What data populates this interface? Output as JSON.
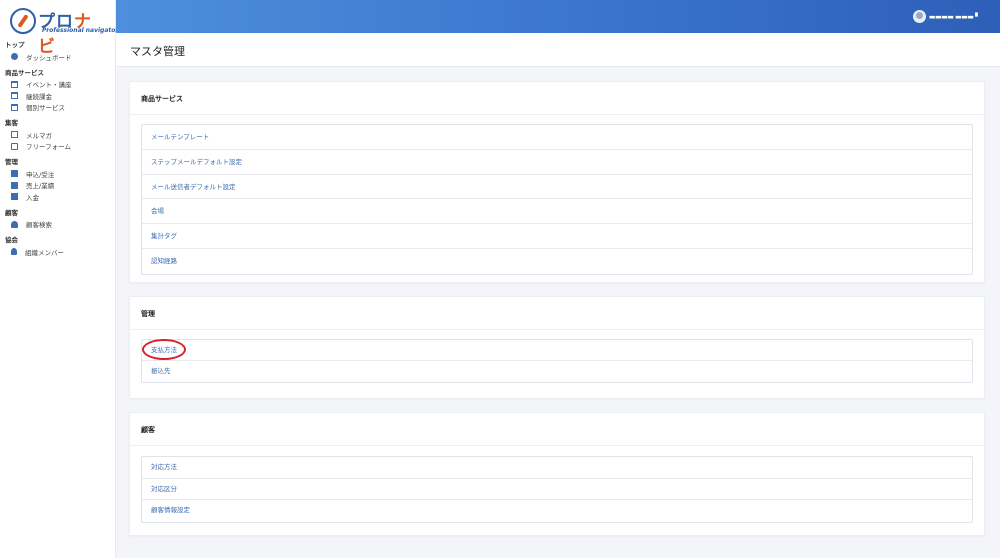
{
  "brand": {
    "logo_text_a": "プロ",
    "logo_text_b": "ナビ",
    "logo_sub": "Professional navigator",
    "primary_color": "#2f5fa8",
    "accent_color": "#e0581d"
  },
  "header": {
    "user_name": "▬▬▬▬ ▬▬▬ ▘",
    "gradient_start": "#4e8fdd",
    "gradient_end": "#2e5fb8"
  },
  "sidebar": {
    "sections": [
      {
        "heading": "トップ",
        "items": [
          {
            "label": "ダッシュボード",
            "icon": "dashboard-icon"
          }
        ]
      },
      {
        "heading": "商品サービス",
        "items": [
          {
            "label": "イベント・講座",
            "icon": "calendar-icon"
          },
          {
            "label": "継続課金",
            "icon": "calendar-icon"
          },
          {
            "label": "個別サービス",
            "icon": "calendar-icon"
          }
        ]
      },
      {
        "heading": "集客",
        "items": [
          {
            "label": "メルマガ",
            "icon": "mail-icon"
          },
          {
            "label": "フリーフォーム",
            "icon": "document-icon"
          }
        ]
      },
      {
        "heading": "管理",
        "items": [
          {
            "label": "申込/受注",
            "icon": "folder-icon"
          },
          {
            "label": "売上/業績",
            "icon": "folder-icon"
          },
          {
            "label": "入金",
            "icon": "folder-icon"
          }
        ]
      },
      {
        "heading": "顧客",
        "items": [
          {
            "label": "顧客検索",
            "icon": "users-icon"
          }
        ]
      },
      {
        "heading": "協会",
        "items": [
          {
            "label": "組織メンバー",
            "icon": "user-icon"
          }
        ]
      }
    ]
  },
  "page": {
    "title": "マスタ管理"
  },
  "cards": {
    "products": {
      "title": "商品サービス",
      "rows": [
        "メールテンプレート",
        "ステップメールデフォルト設定",
        "メール送信者デフォルト設定",
        "会場",
        "集計タグ",
        "認知経路"
      ]
    },
    "management": {
      "title": "管理",
      "rows": [
        "支払方法",
        "振込先"
      ]
    },
    "customers": {
      "title": "顧客",
      "rows": [
        "対応方法",
        "対応区分",
        "顧客情報設定"
      ]
    }
  }
}
